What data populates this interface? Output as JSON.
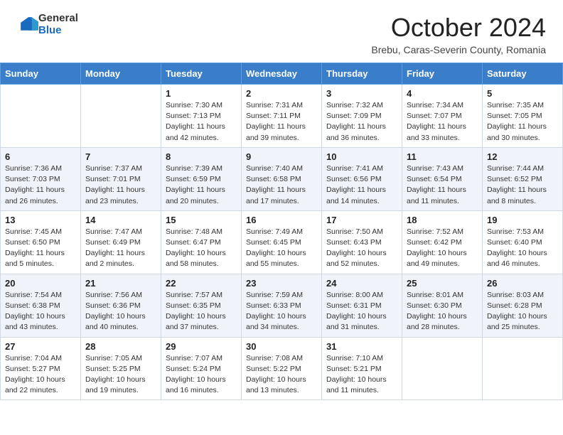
{
  "header": {
    "logo": {
      "general": "General",
      "blue": "Blue"
    },
    "title": "October 2024",
    "location": "Brebu, Caras-Severin County, Romania"
  },
  "days_of_week": [
    "Sunday",
    "Monday",
    "Tuesday",
    "Wednesday",
    "Thursday",
    "Friday",
    "Saturday"
  ],
  "weeks": [
    [
      {
        "day": "",
        "info": ""
      },
      {
        "day": "",
        "info": ""
      },
      {
        "day": "1",
        "info": "Sunrise: 7:30 AM\nSunset: 7:13 PM\nDaylight: 11 hours and 42 minutes."
      },
      {
        "day": "2",
        "info": "Sunrise: 7:31 AM\nSunset: 7:11 PM\nDaylight: 11 hours and 39 minutes."
      },
      {
        "day": "3",
        "info": "Sunrise: 7:32 AM\nSunset: 7:09 PM\nDaylight: 11 hours and 36 minutes."
      },
      {
        "day": "4",
        "info": "Sunrise: 7:34 AM\nSunset: 7:07 PM\nDaylight: 11 hours and 33 minutes."
      },
      {
        "day": "5",
        "info": "Sunrise: 7:35 AM\nSunset: 7:05 PM\nDaylight: 11 hours and 30 minutes."
      }
    ],
    [
      {
        "day": "6",
        "info": "Sunrise: 7:36 AM\nSunset: 7:03 PM\nDaylight: 11 hours and 26 minutes."
      },
      {
        "day": "7",
        "info": "Sunrise: 7:37 AM\nSunset: 7:01 PM\nDaylight: 11 hours and 23 minutes."
      },
      {
        "day": "8",
        "info": "Sunrise: 7:39 AM\nSunset: 6:59 PM\nDaylight: 11 hours and 20 minutes."
      },
      {
        "day": "9",
        "info": "Sunrise: 7:40 AM\nSunset: 6:58 PM\nDaylight: 11 hours and 17 minutes."
      },
      {
        "day": "10",
        "info": "Sunrise: 7:41 AM\nSunset: 6:56 PM\nDaylight: 11 hours and 14 minutes."
      },
      {
        "day": "11",
        "info": "Sunrise: 7:43 AM\nSunset: 6:54 PM\nDaylight: 11 hours and 11 minutes."
      },
      {
        "day": "12",
        "info": "Sunrise: 7:44 AM\nSunset: 6:52 PM\nDaylight: 11 hours and 8 minutes."
      }
    ],
    [
      {
        "day": "13",
        "info": "Sunrise: 7:45 AM\nSunset: 6:50 PM\nDaylight: 11 hours and 5 minutes."
      },
      {
        "day": "14",
        "info": "Sunrise: 7:47 AM\nSunset: 6:49 PM\nDaylight: 11 hours and 2 minutes."
      },
      {
        "day": "15",
        "info": "Sunrise: 7:48 AM\nSunset: 6:47 PM\nDaylight: 10 hours and 58 minutes."
      },
      {
        "day": "16",
        "info": "Sunrise: 7:49 AM\nSunset: 6:45 PM\nDaylight: 10 hours and 55 minutes."
      },
      {
        "day": "17",
        "info": "Sunrise: 7:50 AM\nSunset: 6:43 PM\nDaylight: 10 hours and 52 minutes."
      },
      {
        "day": "18",
        "info": "Sunrise: 7:52 AM\nSunset: 6:42 PM\nDaylight: 10 hours and 49 minutes."
      },
      {
        "day": "19",
        "info": "Sunrise: 7:53 AM\nSunset: 6:40 PM\nDaylight: 10 hours and 46 minutes."
      }
    ],
    [
      {
        "day": "20",
        "info": "Sunrise: 7:54 AM\nSunset: 6:38 PM\nDaylight: 10 hours and 43 minutes."
      },
      {
        "day": "21",
        "info": "Sunrise: 7:56 AM\nSunset: 6:36 PM\nDaylight: 10 hours and 40 minutes."
      },
      {
        "day": "22",
        "info": "Sunrise: 7:57 AM\nSunset: 6:35 PM\nDaylight: 10 hours and 37 minutes."
      },
      {
        "day": "23",
        "info": "Sunrise: 7:59 AM\nSunset: 6:33 PM\nDaylight: 10 hours and 34 minutes."
      },
      {
        "day": "24",
        "info": "Sunrise: 8:00 AM\nSunset: 6:31 PM\nDaylight: 10 hours and 31 minutes."
      },
      {
        "day": "25",
        "info": "Sunrise: 8:01 AM\nSunset: 6:30 PM\nDaylight: 10 hours and 28 minutes."
      },
      {
        "day": "26",
        "info": "Sunrise: 8:03 AM\nSunset: 6:28 PM\nDaylight: 10 hours and 25 minutes."
      }
    ],
    [
      {
        "day": "27",
        "info": "Sunrise: 7:04 AM\nSunset: 5:27 PM\nDaylight: 10 hours and 22 minutes."
      },
      {
        "day": "28",
        "info": "Sunrise: 7:05 AM\nSunset: 5:25 PM\nDaylight: 10 hours and 19 minutes."
      },
      {
        "day": "29",
        "info": "Sunrise: 7:07 AM\nSunset: 5:24 PM\nDaylight: 10 hours and 16 minutes."
      },
      {
        "day": "30",
        "info": "Sunrise: 7:08 AM\nSunset: 5:22 PM\nDaylight: 10 hours and 13 minutes."
      },
      {
        "day": "31",
        "info": "Sunrise: 7:10 AM\nSunset: 5:21 PM\nDaylight: 10 hours and 11 minutes."
      },
      {
        "day": "",
        "info": ""
      },
      {
        "day": "",
        "info": ""
      }
    ]
  ]
}
